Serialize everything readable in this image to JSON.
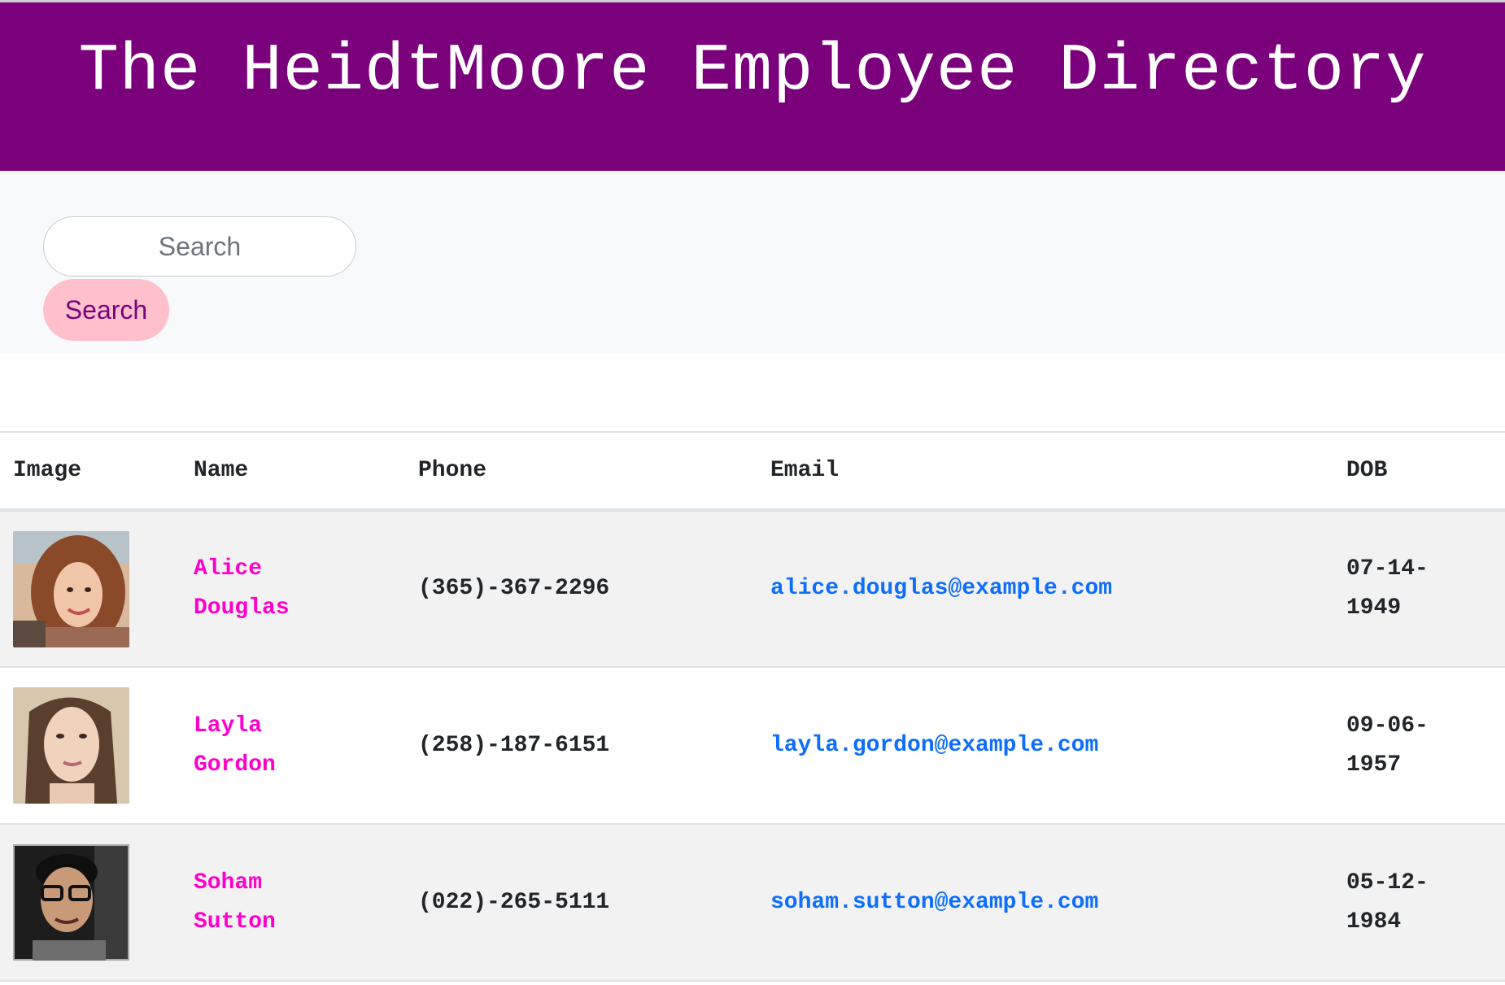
{
  "header": {
    "title": "The HeidtMoore Employee Directory",
    "background_color": "#7b007b"
  },
  "search": {
    "placeholder": "Search",
    "value": "",
    "button_label": "Search",
    "button_color": "#ffc0cb"
  },
  "table": {
    "columns": [
      "Image",
      "Name",
      "Phone",
      "Email",
      "DOB"
    ],
    "rows": [
      {
        "first_name": "Alice",
        "last_name": "Douglas",
        "phone": "(365)-367-2296",
        "email": "alice.douglas@example.com",
        "dob_part1": "07-14-",
        "dob_part2": "1949",
        "image": "alice-douglas-photo"
      },
      {
        "first_name": "Layla",
        "last_name": "Gordon",
        "phone": "(258)-187-6151",
        "email": "layla.gordon@example.com",
        "dob_part1": "09-06-",
        "dob_part2": "1957",
        "image": "layla-gordon-photo"
      },
      {
        "first_name": "Soham",
        "last_name": "Sutton",
        "phone": "(022)-265-5111",
        "email": "soham.sutton@example.com",
        "dob_part1": "05-12-",
        "dob_part2": "1984",
        "image": "soham-sutton-photo"
      }
    ]
  },
  "colors": {
    "name_color": "#ff00cc",
    "email_color": "#0d6efd",
    "striped_row": "#f2f2f2"
  }
}
